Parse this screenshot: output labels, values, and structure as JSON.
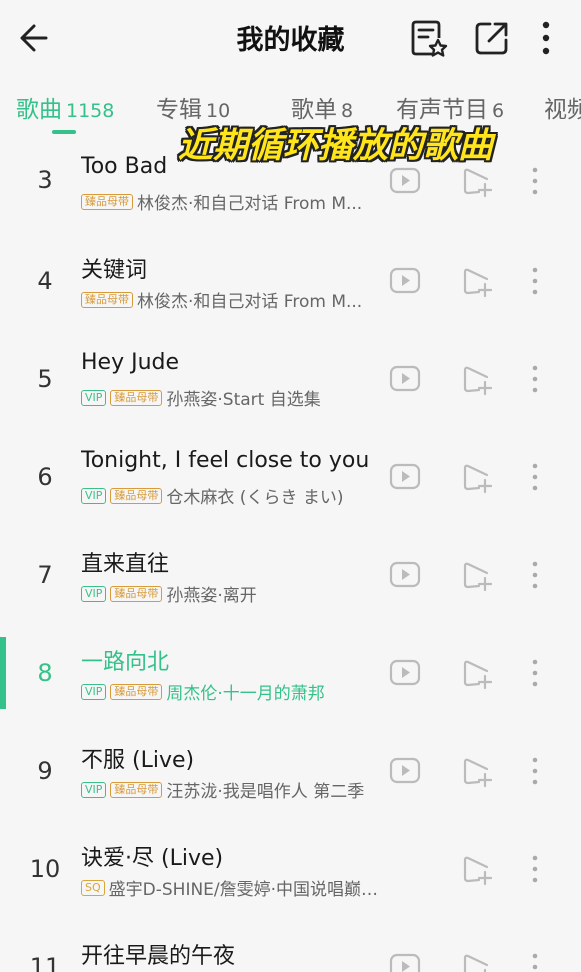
{
  "header": {
    "title": "我的收藏"
  },
  "tabs": [
    {
      "label": "歌曲",
      "count": "1158",
      "active": true
    },
    {
      "label": "专辑",
      "count": "10",
      "active": false
    },
    {
      "label": "歌单",
      "count": "8",
      "active": false
    },
    {
      "label": "有声节目",
      "count": "6",
      "active": false
    },
    {
      "label": "视频",
      "count": "",
      "active": false
    }
  ],
  "overlay_text": "近期循环播放的歌曲",
  "songs": [
    {
      "index": "3",
      "title": "Too Bad",
      "badges": [
        "臻品母带"
      ],
      "meta": "林俊杰·和自己对话 From M...",
      "mv": true
    },
    {
      "index": "4",
      "title": "关键词",
      "badges": [
        "臻品母带"
      ],
      "meta": "林俊杰·和自己对话 From M...",
      "mv": true
    },
    {
      "index": "5",
      "title": "Hey Jude",
      "badges": [
        "VIP",
        "臻品母带"
      ],
      "meta": "孙燕姿·Start 自选集",
      "mv": true
    },
    {
      "index": "6",
      "title": "Tonight, I feel close to you",
      "badges": [
        "VIP",
        "臻品母带"
      ],
      "meta": "仓木麻衣 (くらき まい)",
      "mv": true
    },
    {
      "index": "7",
      "title": "直来直往",
      "badges": [
        "VIP",
        "臻品母带"
      ],
      "meta": "孙燕姿·离开",
      "mv": true
    },
    {
      "index": "8",
      "title": "一路向北",
      "badges": [
        "VIP",
        "臻品母带"
      ],
      "meta": "周杰伦·十一月的萧邦",
      "mv": true,
      "playing": true
    },
    {
      "index": "9",
      "title": "不服 (Live)",
      "badges": [
        "VIP",
        "臻品母带"
      ],
      "meta": "汪苏泷·我是唱作人 第二季",
      "mv": true
    },
    {
      "index": "10",
      "title": "诀爱·尽 (Live)",
      "badges": [
        "SQ"
      ],
      "meta": "盛宇D-SHINE/詹雯婷·中国说唱巅峰对决",
      "mv": false
    },
    {
      "index": "11",
      "title": "开往早晨的午夜",
      "badges": [],
      "meta": "",
      "mv": true
    }
  ],
  "colors": {
    "accent": "#35c18a",
    "overlay": "#ffe51a"
  },
  "icons": [
    "back-arrow-icon",
    "playlist-star-icon",
    "share-icon",
    "more-vertical-icon",
    "mv-play-icon",
    "add-to-playlist-icon"
  ]
}
